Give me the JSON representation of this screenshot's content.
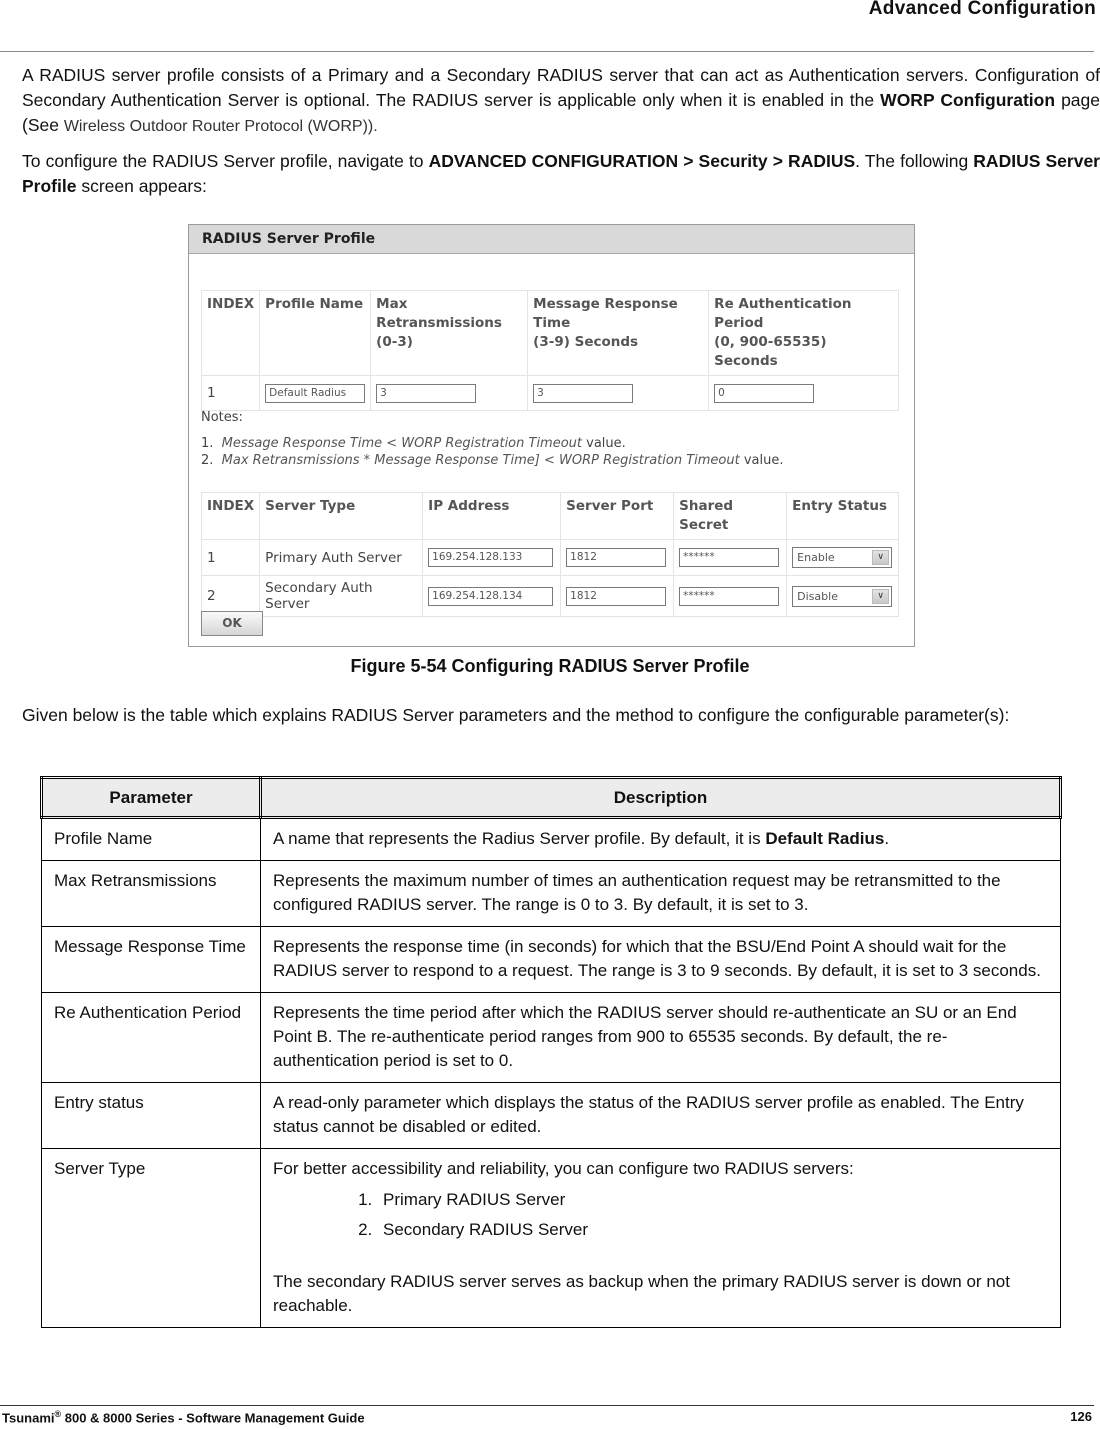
{
  "header": {
    "title": "Advanced Configuration"
  },
  "intro": {
    "p1_a": "A RADIUS server profile consists of a Primary and a Secondary RADIUS server that can act as Authentication servers. Configuration of Secondary Authentication Server is optional. The RADIUS server is applicable only when it is enabled in the ",
    "p1_bold": "WORP Configuration",
    "p1_b": " page (See ",
    "p1_link": "Wireless Outdoor Router Protocol (WORP)).",
    "p2_a": "To configure the RADIUS Server profile, navigate to ",
    "p2_bold_path": "ADVANCED CONFIGURATION > Security > RADIUS",
    "p2_b": ". The following ",
    "p2_bold_screen": "RADIUS Server Profile",
    "p2_c": " screen appears:"
  },
  "figure": {
    "title": "RADIUS Server Profile",
    "profile_table": {
      "headers": {
        "index": "INDEX",
        "profile_name": "Profile Name",
        "max_retx_1": "Max",
        "max_retx_2": "Retransmissions",
        "max_retx_3": "(0-3)",
        "mrt_1": "Message Response",
        "mrt_2": "Time",
        "mrt_3": "(3-9) Seconds",
        "reauth_1": "Re Authentication",
        "reauth_2": "Period",
        "reauth_3": "(0, 900-65535) Seconds"
      },
      "row": {
        "index": "1",
        "profile_name": "Default Radius",
        "max_retransmissions": "3",
        "message_response_time": "3",
        "reauth_period": "0"
      }
    },
    "notes": {
      "title": "Notes:",
      "n1_num": "1.",
      "n1_italic": "Message Response Time < WORP Registration Timeout",
      "n1_tail": " value.",
      "n2_num": "2.",
      "n2_italic": "Max Retransmissions * Message Response Time] < WORP Registration Timeout",
      "n2_tail": " value."
    },
    "server_table": {
      "headers": [
        "INDEX",
        "Server Type",
        "IP Address",
        "Server Port",
        "Shared Secret",
        "Entry Status"
      ],
      "rows": [
        {
          "index": "1",
          "server_type": "Primary Auth Server",
          "ip": "169.254.128.133",
          "port": "1812",
          "secret": "******",
          "status": "Enable"
        },
        {
          "index": "2",
          "server_type": "Secondary Auth Server",
          "ip": "169.254.128.134",
          "port": "1812",
          "secret": "******",
          "status": "Disable"
        }
      ]
    },
    "ok_label": "OK",
    "chevron_glyph": "∨"
  },
  "caption": "Figure 5-54 Configuring RADIUS Server Profile",
  "p3": "Given below is the table which explains RADIUS Server parameters and the method to configure the configurable parameter(s):",
  "param_table": {
    "headers": {
      "parameter": "Parameter",
      "description": "Description"
    },
    "rows": [
      {
        "parameter": "Profile Name",
        "desc_a": "A name that represents the Radius Server profile. By default, it is ",
        "desc_bold": "Default Radius",
        "desc_b": "."
      },
      {
        "parameter": "Max Retransmissions",
        "desc": "Represents the maximum number of times an authentication request may be retransmitted to the configured RADIUS server. The range is 0 to 3. By default, it is set to 3."
      },
      {
        "parameter": "Message Response Time",
        "desc": "Represents the response time (in seconds) for which that the BSU/End Point A should wait for the RADIUS server to respond to a request. The range is 3 to 9 seconds. By default, it is set to 3 seconds."
      },
      {
        "parameter": "Re Authentication Period",
        "desc": "Represents the time period after which the RADIUS server should re-authenticate an SU or an End Point B. The re-authenticate period ranges from 900 to 65535 seconds. By default, the re-authentication period is set to 0."
      },
      {
        "parameter": "Entry status",
        "desc": "A read-only parameter which displays the status of the RADIUS server profile as enabled. The Entry status cannot be disabled or edited."
      },
      {
        "parameter": "Server Type",
        "desc_intro": "For better accessibility and reliability, you can configure two RADIUS servers:",
        "list": [
          "Primary RADIUS Server",
          "Secondary RADIUS Server"
        ],
        "desc_after": "The secondary RADIUS server serves as backup when the primary RADIUS server is down or not reachable."
      }
    ]
  },
  "footer": {
    "product": "Tsunami",
    "reg": "®",
    "rest": " 800 & 8000 Series - Software Management Guide",
    "page_number": "126"
  }
}
